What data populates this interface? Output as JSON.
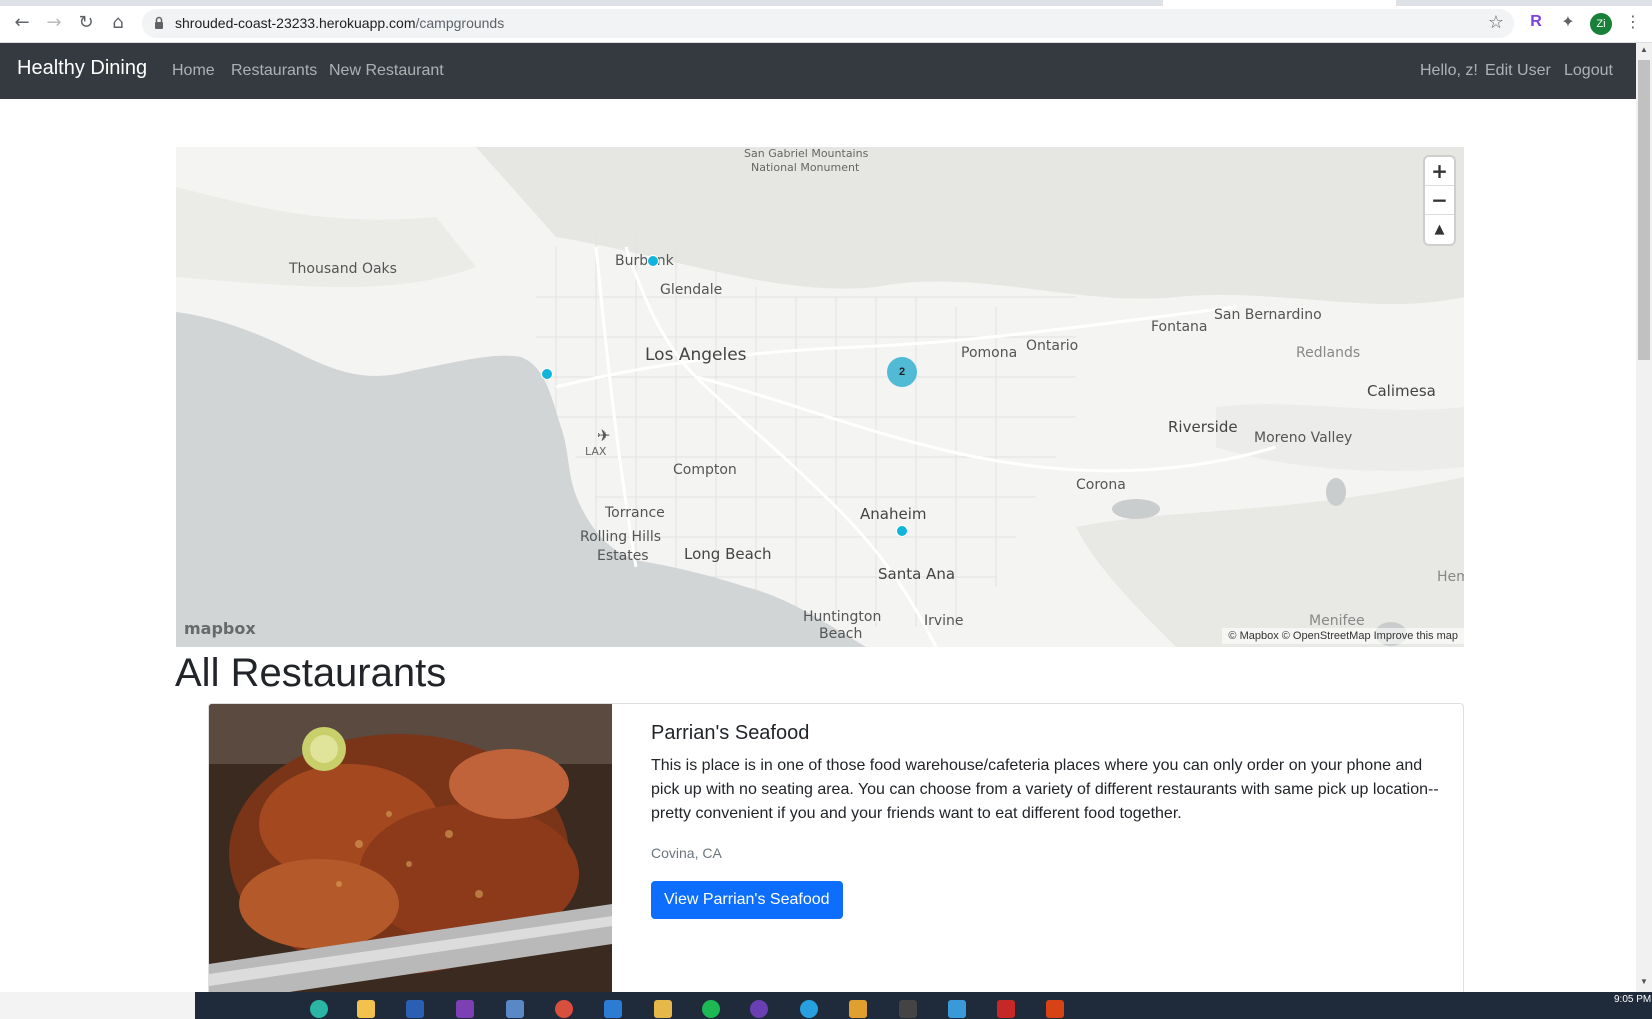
{
  "browser": {
    "url_host": "shrouded-coast-23233.herokuapp.com",
    "url_path": "/campgrounds",
    "profile_initial": "Zi"
  },
  "navbar": {
    "brand": "Healthy Dining",
    "links": [
      "Home",
      "Restaurants",
      "New Restaurant"
    ],
    "greeting": "Hello, z!",
    "edit_user": "Edit User",
    "logout": "Logout"
  },
  "map": {
    "labels": {
      "san_gabriel": "San Gabriel Mountains",
      "national_monument": "National Monument",
      "thousand_oaks": "Thousand Oaks",
      "burbank": "Burbank",
      "glendale": "Glendale",
      "los_angeles": "Los Angeles",
      "pomona": "Pomona",
      "ontario": "Ontario",
      "fontana": "Fontana",
      "san_bernardino": "San Bernardino",
      "redlands": "Redlands",
      "calimesa": "Calimesa",
      "riverside": "Riverside",
      "moreno_valley": "Moreno Valley",
      "lax": "LAX",
      "compton": "Compton",
      "corona": "Corona",
      "torrance": "Torrance",
      "rolling_hills": "Rolling Hills",
      "estates": "Estates",
      "long_beach": "Long Beach",
      "anaheim": "Anaheim",
      "santa_ana": "Santa Ana",
      "huntington": "Huntington",
      "beach": "Beach",
      "irvine": "Irvine",
      "menifee": "Menifee",
      "hem": "Hem"
    },
    "cluster_count": "2",
    "logo": "mapbox",
    "attribution": "© Mapbox © OpenStreetMap Improve this map"
  },
  "page": {
    "heading": "All Restaurants"
  },
  "restaurants": [
    {
      "title": "Parrian's Seafood",
      "description": "This is place is in one of those food warehouse/cafeteria places where you can only order on your phone and pick up with no seating area. You can choose from a variety of different restaurants with same pick up location--pretty convenient if you and your friends want to eat different food together.",
      "location": "Covina, CA",
      "button_label": "View Parrian's Seafood"
    }
  ],
  "taskbar": {
    "time": "9:05 PM"
  },
  "colors": {
    "navbar_bg": "#343a40",
    "primary_button": "#0d6efd",
    "map_marker": "#11b4da",
    "map_cluster": "#51bbd6"
  }
}
